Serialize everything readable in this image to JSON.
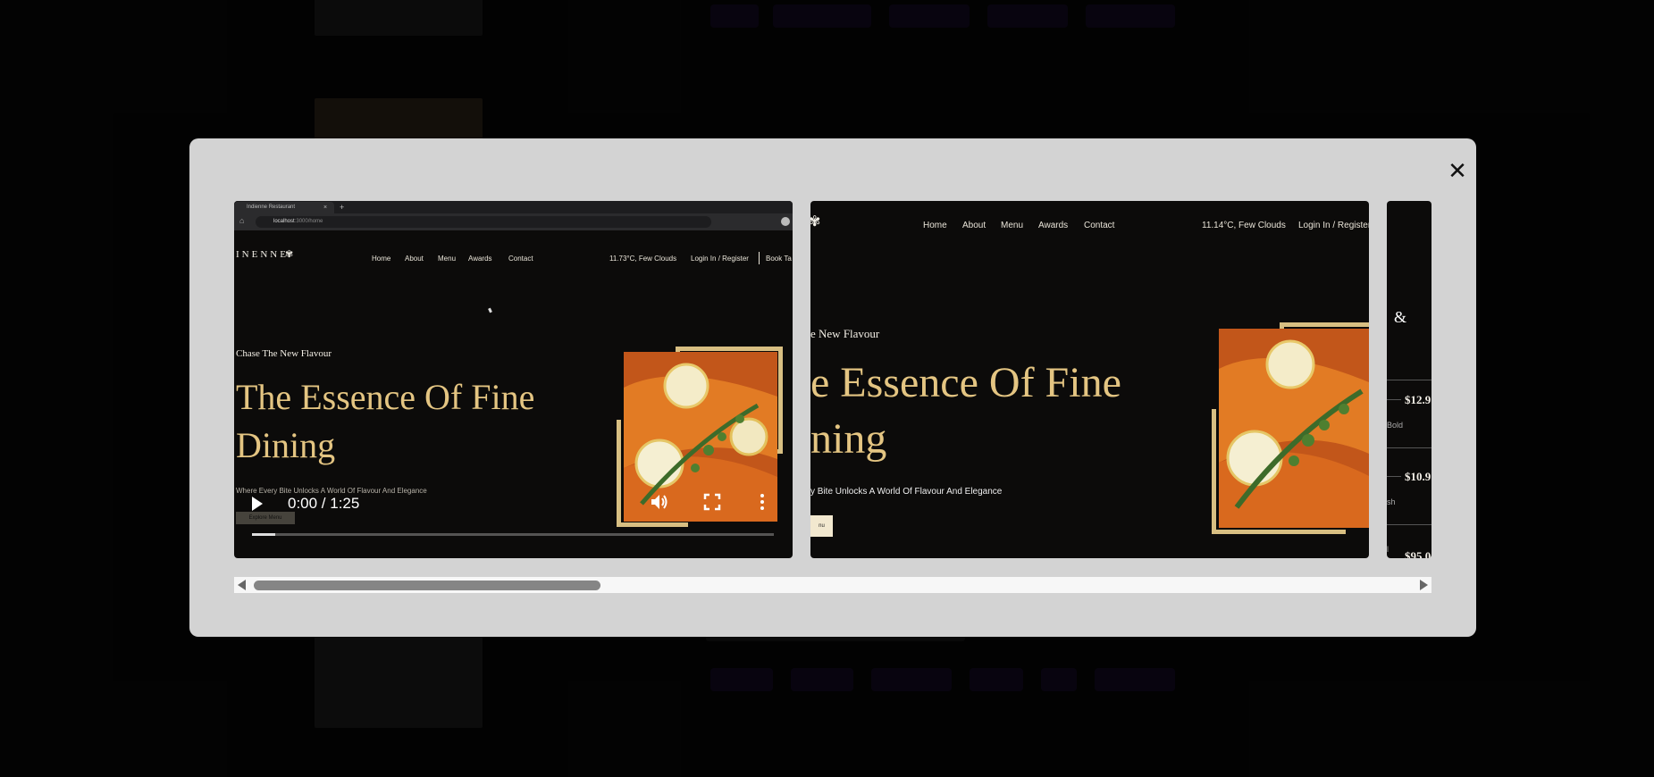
{
  "modal": {
    "close_glyph": "✕"
  },
  "video": {
    "browser": {
      "tab_title": "Indienne Restaurant",
      "tab_close": "×",
      "new_tab": "+",
      "url_host": "localhost",
      "url_path": ":3000/home"
    },
    "site": {
      "logo": "INENNE",
      "nav": [
        "Home",
        "About",
        "Menu",
        "Awards",
        "Contact"
      ],
      "weather": "11.73°C, Few Clouds",
      "login": "Login In / Register",
      "book": "Book Ta",
      "tagline": "Chase The New Flavour",
      "heading_line1": "The Essence Of Fine",
      "heading_line2": "Dining",
      "subtitle": "Where Every Bite Unlocks A World Of Flavour And Elegance",
      "button": "Explore Menu"
    },
    "controls": {
      "time": "0:00 / 1:25",
      "progress_fraction": 0.04
    }
  },
  "slide2": {
    "nav": [
      "Home",
      "About",
      "Menu",
      "Awards",
      "Contact"
    ],
    "weather": "11.14°C, Few Clouds",
    "login": "Login In / Register",
    "tagline": "e New Flavour",
    "heading_line1": "e Essence Of Fine",
    "heading_line2": "ning",
    "subtitle": "y Bite Unlocks A World Of Flavour And Elegance",
    "button": "nu"
  },
  "slide3": {
    "icon": "&",
    "items": [
      {
        "price": "$12.9",
        "desc": "Bold"
      },
      {
        "price": "$10.9",
        "desc": "sh"
      },
      {
        "price": "$95.0",
        "desc": "l"
      }
    ]
  },
  "scrollbar": {
    "position_fraction": 0.0
  }
}
